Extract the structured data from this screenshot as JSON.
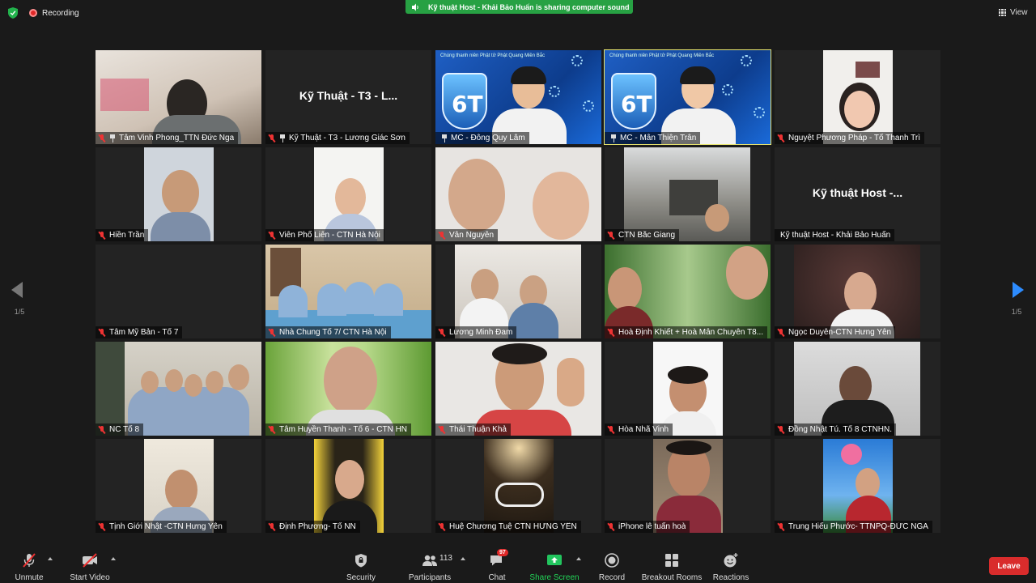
{
  "top": {
    "recording": "Recording",
    "share_banner": "Kỹ thuật Host - Khải Bảo Huấn is sharing computer sound",
    "view": "View"
  },
  "tiles": [
    {
      "name": "Tâm Vinh Phong_TTN Đức Nga",
      "muted": true,
      "pinned": true
    },
    {
      "name": "Kỹ Thuật - T3 - Lương Giác Sơn",
      "muted": true,
      "pinned": true,
      "big_name": "Kỹ Thuật - T3 - L..."
    },
    {
      "name": "MC - Đông Quy Lâm",
      "muted": false,
      "pinned": true
    },
    {
      "name": "MC - Mẫn Thiện Trân",
      "muted": false,
      "pinned": true
    },
    {
      "name": "Nguyệt Phương Pháp - Tổ Thanh Trì",
      "muted": true,
      "pinned": false
    },
    {
      "name": "Hiền Trần",
      "muted": true
    },
    {
      "name": "Viên Phổ Liên - CTN Hà Nội",
      "muted": true
    },
    {
      "name": "Vân Nguyễn",
      "muted": true
    },
    {
      "name": "CTN Bắc Giang",
      "muted": true
    },
    {
      "name": "Kỹ thuật Host - Khải Bảo Huấn",
      "muted": false,
      "big_name": "Kỹ thuật Host -..."
    },
    {
      "name": "Tâm Mỹ Bản - Tổ 7",
      "muted": true
    },
    {
      "name": "Nhà Chung Tổ 7/ CTN Hà Nội",
      "muted": true
    },
    {
      "name": "Lương Minh Đam",
      "muted": true
    },
    {
      "name": "Hoà Định Khiết + Hoà Mẫn Chuyên T8...",
      "muted": true
    },
    {
      "name": "Ngọc Duyên-CTN Hưng Yên",
      "muted": true
    },
    {
      "name": "NC Tổ 8",
      "muted": true
    },
    {
      "name": "Tâm Huyền Thanh - Tổ 6 - CTN HN",
      "muted": true
    },
    {
      "name": "Thái Thuận Khả",
      "muted": true
    },
    {
      "name": "Hòa Nhã Vinh",
      "muted": true
    },
    {
      "name": "Đồng Nhật Tú. Tổ 8 CTNHN.",
      "muted": true
    },
    {
      "name": "Tịnh Giới Nhật -CTN Hưng Yên",
      "muted": true
    },
    {
      "name": "Định Phương- Tổ NN",
      "muted": true
    },
    {
      "name": "Huệ Chương Tuệ CTN HƯNG YÊN",
      "muted": true
    },
    {
      "name": "iPhone lê tuấn hoà",
      "muted": true
    },
    {
      "name": "Trung Hiếu Phước- TTNPQ-ĐỨC NGA",
      "muted": true
    }
  ],
  "mc_header": "Chúng thanh niên Phật tử Phật Quang Miền Bắc",
  "pager": {
    "left": "1/5",
    "right": "1/5"
  },
  "toolbar": {
    "unmute": "Unmute",
    "start_video": "Start Video",
    "security": "Security",
    "participants": "Participants",
    "participant_count": "113",
    "chat": "Chat",
    "chat_badge": "97",
    "share_screen": "Share Screen",
    "record": "Record",
    "breakout": "Breakout Rooms",
    "reactions": "Reactions",
    "leave": "Leave"
  }
}
